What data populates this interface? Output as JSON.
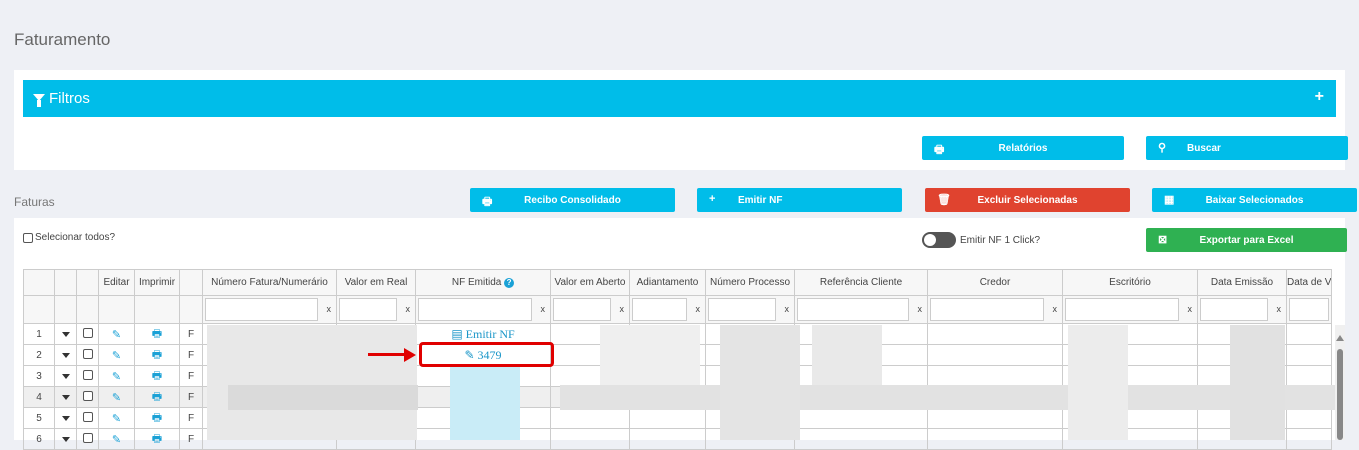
{
  "page": {
    "title": "Faturamento"
  },
  "filters": {
    "label": "Filtros",
    "expand_icon": "+"
  },
  "filter_actions": {
    "relatorios": "Relatórios",
    "buscar": "Buscar"
  },
  "section": {
    "label": "Faturas"
  },
  "toolbar": {
    "recibo": "Recibo Consolidado",
    "emitir": "Emitir NF",
    "excluir": "Excluir Selecionadas",
    "baixar": "Baixar Selecionados",
    "exportar": "Exportar para Excel",
    "select_all": "Selecionar todos?",
    "emitir_1click": "Emitir NF 1 Click?"
  },
  "colors": {
    "accent": "#00bde9",
    "danger": "#e0432f",
    "success": "#2fb152",
    "highlight": "#e00000",
    "link": "#1a96c8"
  },
  "table": {
    "columns": [
      "",
      "",
      "",
      "Editar",
      "Imprimir",
      "",
      "Número Fatura/Numerário",
      "Valor em Real",
      "NF Emitida",
      "Valor em Aberto",
      "Adiantamento",
      "Número Processo",
      "Referência Cliente",
      "Credor",
      "Escritório",
      "Data Emissão",
      "Data de V"
    ],
    "filter_clear": "x",
    "rows": [
      {
        "num": "1",
        "tipo": "F",
        "nf": "Emitir NF"
      },
      {
        "num": "2",
        "tipo": "F",
        "nf": "3479"
      },
      {
        "num": "3",
        "tipo": "F",
        "nf": ""
      },
      {
        "num": "4",
        "tipo": "F",
        "nf": ""
      },
      {
        "num": "5",
        "tipo": "F",
        "nf": ""
      },
      {
        "num": "6",
        "tipo": "F",
        "nf": ""
      }
    ]
  }
}
